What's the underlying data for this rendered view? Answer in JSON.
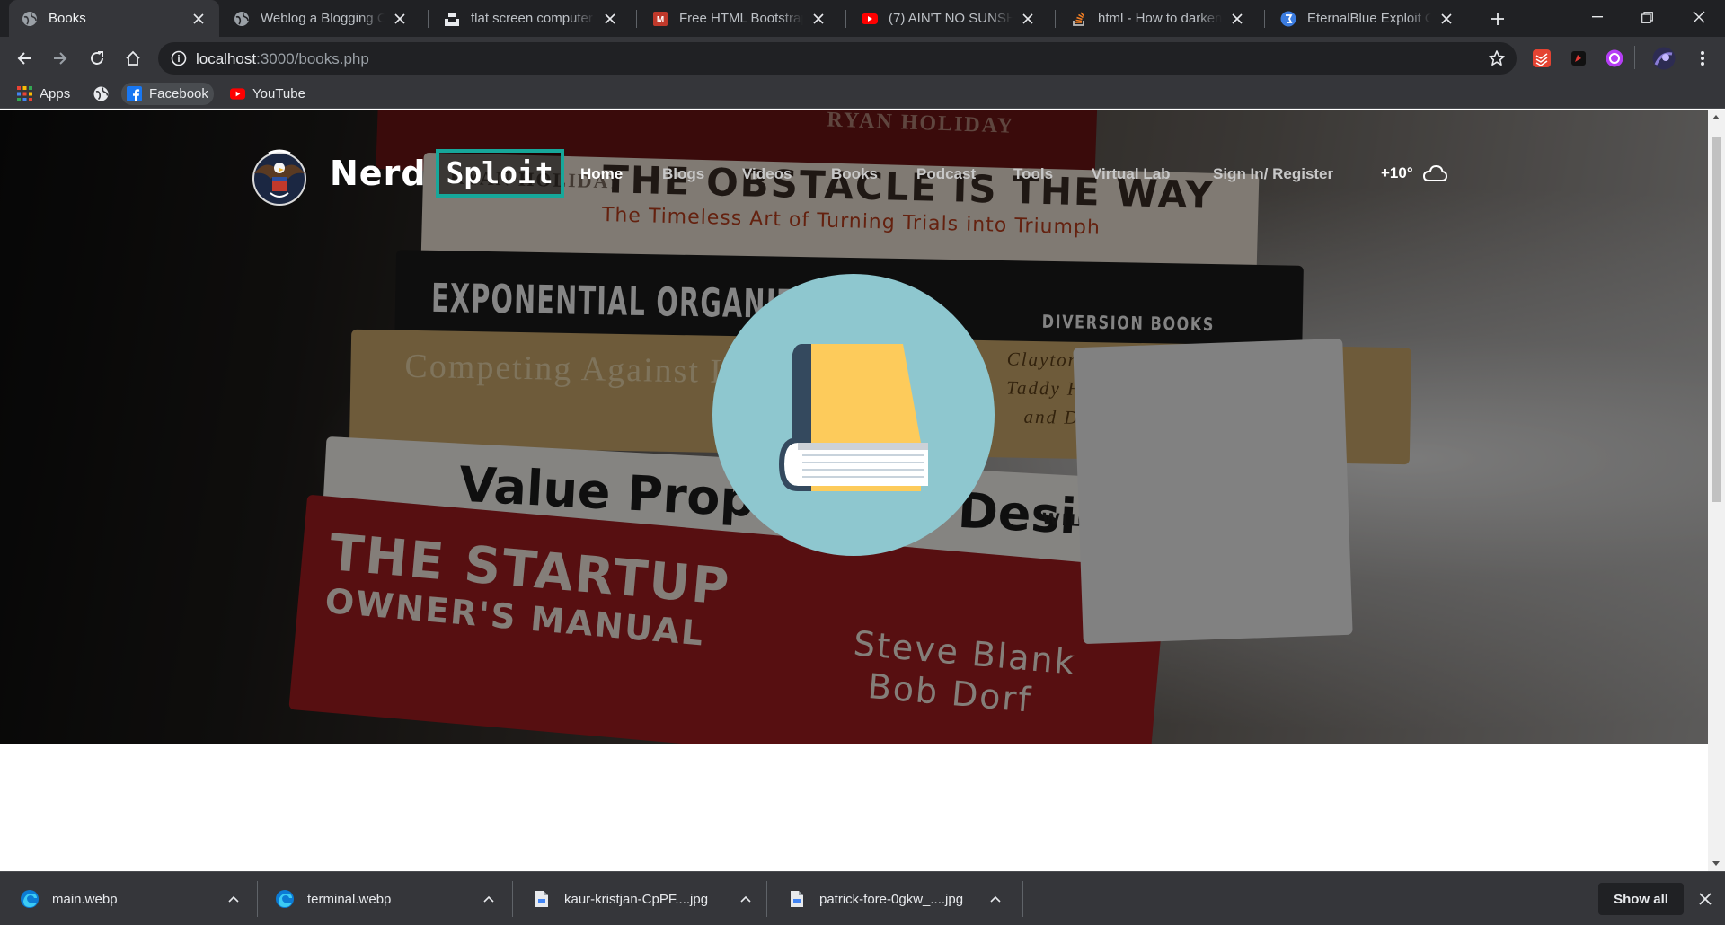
{
  "browser": {
    "tabs": [
      {
        "title": "Books",
        "active": true,
        "favicon": "globe-icon"
      },
      {
        "title": "Weblog a Blogging Cat",
        "favicon": "globe-icon"
      },
      {
        "title": "flat screen computer m",
        "favicon": "unsplash-icon"
      },
      {
        "title": "Free HTML Bootstrap V",
        "favicon": "template-icon"
      },
      {
        "title": "(7) AIN'T NO SUNSHIN",
        "favicon": "youtube-icon"
      },
      {
        "title": "html - How to darken a",
        "favicon": "stackoverflow-icon"
      },
      {
        "title": "EternalBlue Exploit On",
        "favicon": "shield-icon"
      }
    ],
    "address": {
      "host": "localhost",
      "path": ":3000/books.php"
    },
    "bookmarks": [
      {
        "label": "Apps",
        "icon": "apps-grid-icon"
      },
      {
        "label": "",
        "icon": "globe-icon"
      },
      {
        "label": "Facebook",
        "icon": "facebook-icon"
      },
      {
        "label": "YouTube",
        "icon": "youtube-icon"
      }
    ]
  },
  "site": {
    "brand": {
      "part1": "Nerd",
      "part2": "Sploit"
    },
    "menu": [
      {
        "label": "Home",
        "current": true
      },
      {
        "label": "Blogs"
      },
      {
        "label": "Videos"
      },
      {
        "label": "Books"
      },
      {
        "label": "Podcast"
      },
      {
        "label": "Tools"
      },
      {
        "label": "Virtual Lab"
      },
      {
        "label": "Sign In/ Register"
      }
    ],
    "weather": {
      "temp": "+10°",
      "icon": "cloud-icon"
    },
    "hero_books": [
      "RYAN HOLIDAY",
      "THE OBSTACLE IS THE WAY",
      "The Timeless Art of Turning Trials into Triumph",
      "EXPONENTIAL ORGANIZATIONS",
      "DIVERSION BOOKS",
      "Competing Against Luck",
      "Clayton M. Christensen",
      "Taddy Hall, Karen Dillon,",
      "and David S. Duncan",
      "Value Proposition Design",
      "WILEY",
      "THE STARTUP",
      "OWNER'S MANUAL",
      "Steve Blank",
      "Bob Dorf"
    ]
  },
  "downloads": {
    "items": [
      {
        "name": "main.webp",
        "icon": "edge-icon"
      },
      {
        "name": "terminal.webp",
        "icon": "edge-icon"
      },
      {
        "name": "kaur-kristjan-CpPF....jpg",
        "icon": "file-icon"
      },
      {
        "name": "patrick-fore-0gkw_....jpg",
        "icon": "file-icon"
      }
    ],
    "show_all": "Show all"
  },
  "colors": {
    "tabstrip": "#202124",
    "toolbar": "#35363a",
    "brand_accent": "#16a79a",
    "hero_circle": "#8ec7cf",
    "book_cover": "#fdcb5b",
    "book_spine": "#34495e"
  }
}
